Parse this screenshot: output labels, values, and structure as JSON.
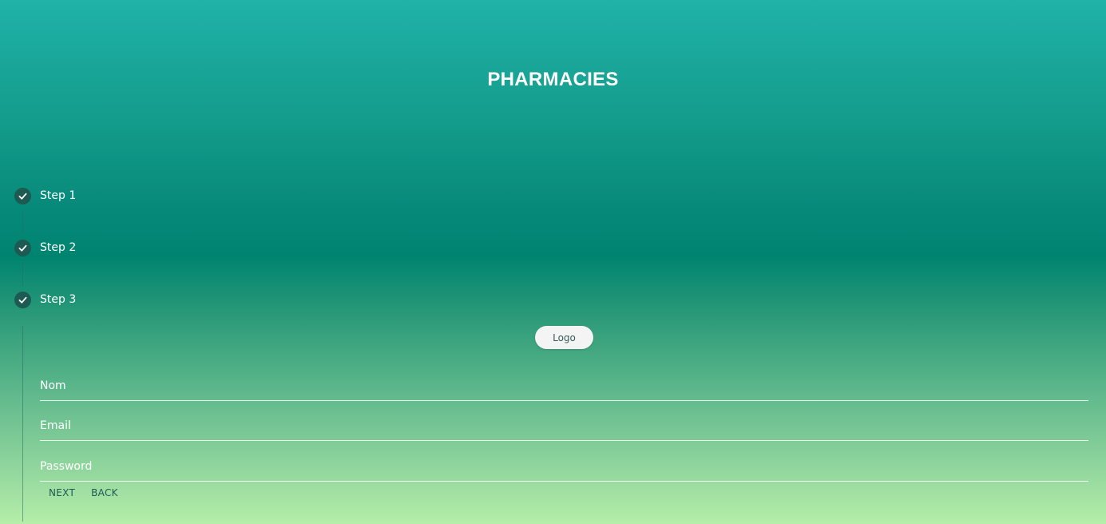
{
  "header": {
    "title": "PHARMACIES"
  },
  "stepper": {
    "steps": [
      {
        "label": "Step 1",
        "status": "completed",
        "icon": "check-icon"
      },
      {
        "label": "Step 2",
        "status": "completed",
        "icon": "check-icon"
      },
      {
        "label": "Step 3",
        "status": "completed",
        "icon": "check-icon"
      }
    ]
  },
  "form": {
    "logo_button_label": "Logo",
    "fields": [
      {
        "label": "Nom",
        "value": ""
      },
      {
        "label": "Email",
        "value": ""
      },
      {
        "label": "Password",
        "value": ""
      }
    ],
    "next_label": "NEXT",
    "back_label": "BACK"
  },
  "colors": {
    "background_top": "#20b2a8",
    "background_middle": "#008470",
    "background_bottom": "#b5eea9",
    "step_circle": "#1d5a52",
    "action_text": "#1f5a55"
  }
}
